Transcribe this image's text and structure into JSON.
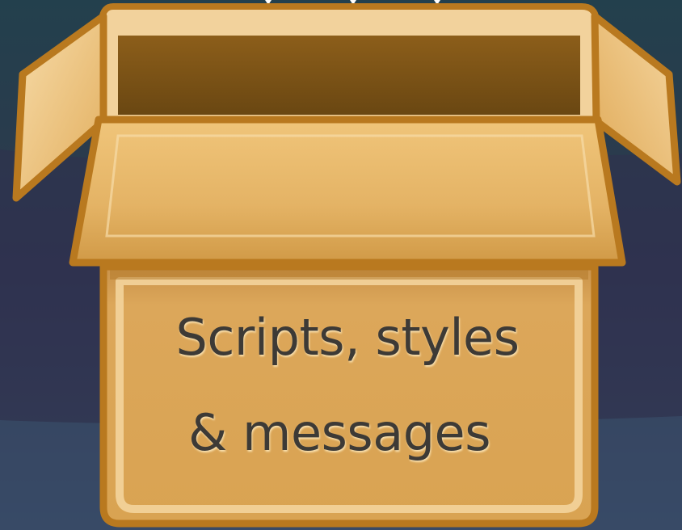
{
  "slide": {
    "caption_line1": "Scripts, styles",
    "caption_line2": "& messages",
    "icon": "cardboard-box-icon"
  },
  "colors": {
    "background_top": "#23404d",
    "background_band": "#2f3350",
    "background_bottom": "#3a506c",
    "box_fill": "#d9a557",
    "box_outline": "#b9791f",
    "box_highlight": "#f3d49c",
    "box_inner_shadow": "#6a4712",
    "text": "#3d3a36"
  }
}
